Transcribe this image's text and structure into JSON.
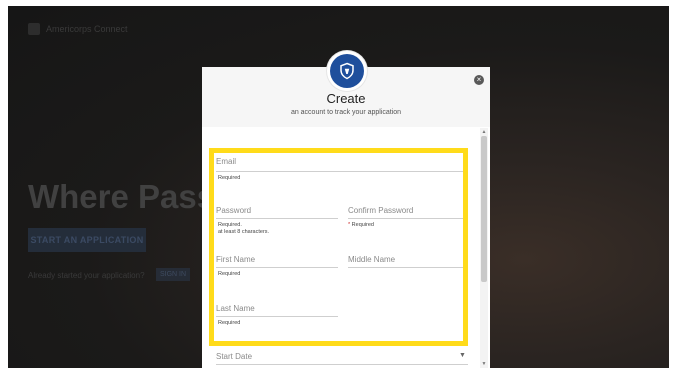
{
  "background": {
    "brand_text": "Americorps Connect",
    "headline": "Where Passi",
    "cta_label": "START AN APPLICATION",
    "already_text": "Already started your application?",
    "signin_label": "SIGN IN"
  },
  "modal": {
    "title": "Create",
    "subtitle": "an account to track your application",
    "close_icon": "×",
    "fields": {
      "email": {
        "label": "Email",
        "helper": "Required"
      },
      "password": {
        "label": "Password",
        "helper1": "Required.",
        "helper2": "at least 8 characters."
      },
      "confirm_password": {
        "label": "Confirm Password",
        "helper": "Required"
      },
      "first_name": {
        "label": "First Name",
        "helper": "Required"
      },
      "middle_name": {
        "label": "Middle Name"
      },
      "last_name": {
        "label": "Last Name",
        "helper": "Required"
      },
      "start_date": {
        "label": "Start Date",
        "dropdown_icon": "▼"
      }
    }
  },
  "colors": {
    "highlight": "#ffdb1a",
    "badge": "#1f4f9c"
  }
}
